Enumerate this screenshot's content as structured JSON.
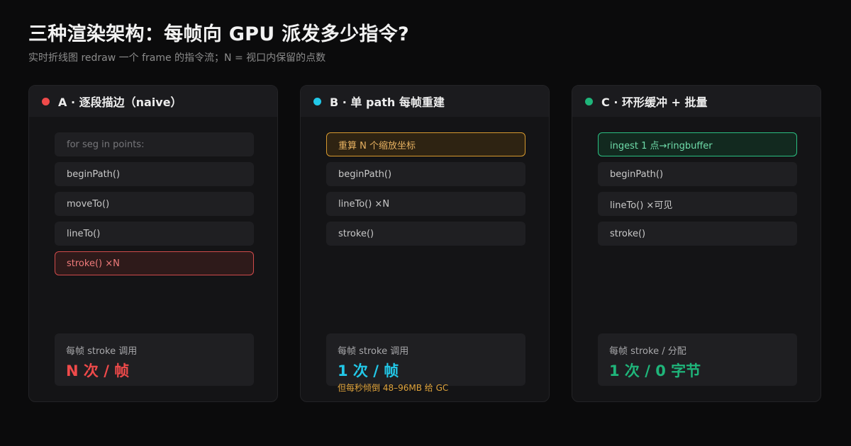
{
  "page": {
    "title": "三种渲染架构：每帧向 GPU 派发多少指令?",
    "subtitle": "实时折线图 redraw 一个 frame 的指令流；N = 视口内保留的点数"
  },
  "colors": {
    "red": "#ef4a4a",
    "cyan": "#22c8e8",
    "green": "#1fb57a",
    "amber": "#e0a43c"
  },
  "panels": [
    {
      "title": "A · 逐段描边（naive）",
      "steps": [
        "for seg in points:",
        "beginPath()",
        "moveTo()",
        "lineTo()",
        "stroke() ×N"
      ],
      "summary_label": "每帧 stroke 调用",
      "summary_value": "N 次 / 帧",
      "summary_note": ""
    },
    {
      "title": "B · 单 path 每帧重建",
      "steps": [
        "重算 N 个缩放坐标",
        "beginPath()",
        "lineTo() ×N",
        "stroke()"
      ],
      "summary_label": "每帧 stroke 调用",
      "summary_value": "1 次 / 帧",
      "summary_note": "但每秒倾倒 48–96MB 给 GC"
    },
    {
      "title": "C · 环形缓冲 + 批量",
      "steps": [
        "ingest 1 点→ringbuffer",
        "beginPath()",
        "lineTo() ×可见",
        "stroke()"
      ],
      "summary_label": "每帧 stroke / 分配",
      "summary_value": "1 次 / 0 字节",
      "summary_note": ""
    }
  ]
}
